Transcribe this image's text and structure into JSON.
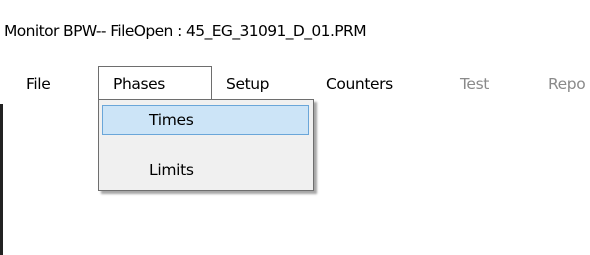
{
  "window": {
    "title": "Monitor BPW-- FileOpen : 45_EG_31091_D_01.PRM"
  },
  "menubar": {
    "items": [
      {
        "label": "File",
        "enabled": true
      },
      {
        "label": "Phases",
        "enabled": true,
        "open": true
      },
      {
        "label": "Setup",
        "enabled": true
      },
      {
        "label": "Counters",
        "enabled": true
      },
      {
        "label": "Test",
        "enabled": false
      },
      {
        "label": "Repo",
        "enabled": false
      }
    ]
  },
  "phases_menu": {
    "items": [
      {
        "label": "Times",
        "highlighted": true
      },
      {
        "label": "Limits",
        "highlighted": false
      }
    ]
  },
  "colors": {
    "highlight_fill": "#cce4f7",
    "highlight_border": "#6aa6d9",
    "disabled_text": "#8a8a8a",
    "menu_background": "#f0f0f0"
  }
}
